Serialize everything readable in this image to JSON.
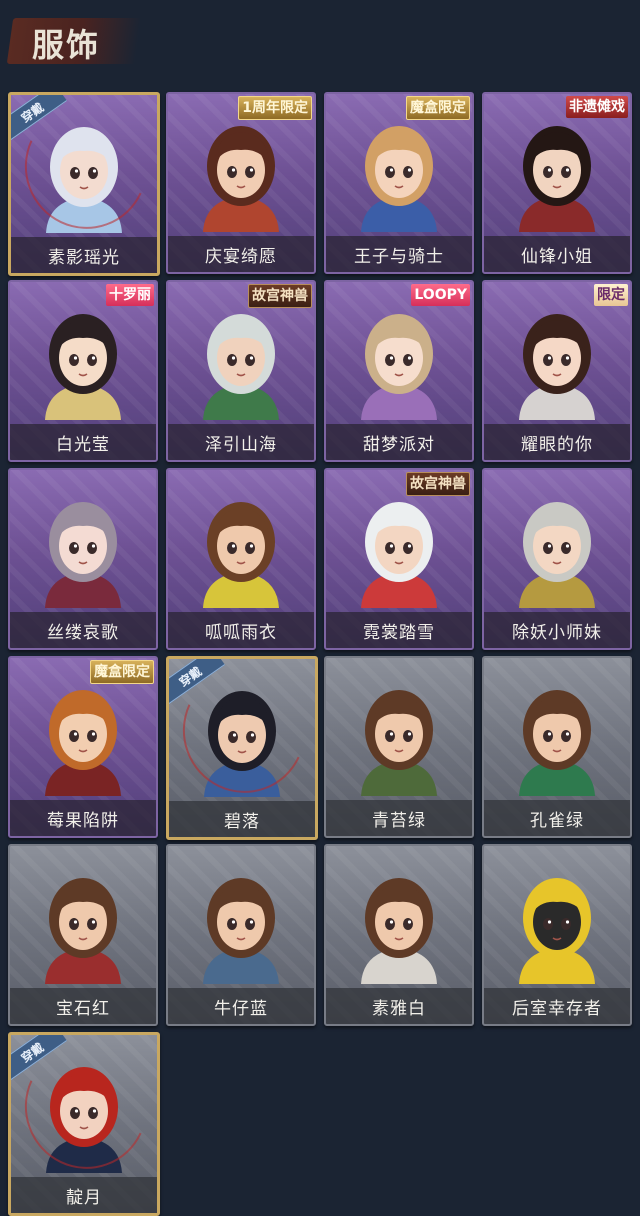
{
  "header": {
    "title": "服饰"
  },
  "cards": [
    {
      "name": "素影瑶光",
      "theme": "purple",
      "worn": true,
      "worn_label": "穿戴",
      "badge": "",
      "hair": "#dfe3ee",
      "skin": "#f3dcd0",
      "outfit": "#a7c6e6"
    },
    {
      "name": "庆宴绮愿",
      "theme": "purple",
      "worn": false,
      "worn_label": "",
      "badge": "1周年限定",
      "badge_style": "gold",
      "hair": "#5a2b1e",
      "skin": "#f1cdb3",
      "outfit": "#b0452f"
    },
    {
      "name": "王子与骑士",
      "theme": "purple",
      "worn": false,
      "worn_label": "",
      "badge": "魔盒限定",
      "badge_style": "gold",
      "hair": "#d2a065",
      "skin": "#f4d3bb",
      "outfit": "#3b5ea8"
    },
    {
      "name": "仙锋小姐",
      "theme": "purple",
      "worn": false,
      "worn_label": "",
      "badge": "非遗傩戏",
      "badge_style": "red",
      "hair": "#241714",
      "skin": "#f1d4c0",
      "outfit": "#8a2a2a"
    },
    {
      "name": "白光莹",
      "theme": "purple",
      "worn": false,
      "worn_label": "",
      "badge": "十罗丽",
      "badge_style": "pink",
      "hair": "#2a2022",
      "skin": "#f5dcc8",
      "outfit": "#d9c27a"
    },
    {
      "name": "泽引山海",
      "theme": "purple",
      "worn": false,
      "worn_label": "",
      "badge": "故宫神兽",
      "badge_style": "dark",
      "hair": "#d4dbd9",
      "skin": "#f0d2bd",
      "outfit": "#3f7a4a"
    },
    {
      "name": "甜梦派对",
      "theme": "purple",
      "worn": false,
      "worn_label": "",
      "badge": "LOOPY",
      "badge_style": "pink",
      "hair": "#cbb08a",
      "skin": "#f6ddcd",
      "outfit": "#9a6fb8"
    },
    {
      "name": "耀眼的你",
      "theme": "purple",
      "worn": false,
      "worn_label": "",
      "badge": "限定",
      "badge_style": "cream",
      "hair": "#3a221b",
      "skin": "#f5d8c6",
      "outfit": "#d6d2d0"
    },
    {
      "name": "丝缕哀歌",
      "theme": "purple",
      "worn": false,
      "worn_label": "",
      "badge": "",
      "hair": "#9a8e9e",
      "skin": "#f4dbd3",
      "outfit": "#7a2a3c"
    },
    {
      "name": "呱呱雨衣",
      "theme": "purple",
      "worn": false,
      "worn_label": "",
      "badge": "",
      "hair": "#6b4026",
      "skin": "#efc9ac",
      "outfit": "#d7c53a"
    },
    {
      "name": "霓裳踏雪",
      "theme": "purple",
      "worn": false,
      "worn_label": "",
      "badge": "故宫神兽",
      "badge_style": "dark",
      "hair": "#eceff0",
      "skin": "#f3d6c2",
      "outfit": "#cc3a3a"
    },
    {
      "name": "除妖小师妹",
      "theme": "purple",
      "worn": false,
      "worn_label": "",
      "badge": "",
      "hair": "#c9c9c4",
      "skin": "#f3d7c3",
      "outfit": "#b59a40"
    },
    {
      "name": "莓果陷阱",
      "theme": "purple",
      "worn": false,
      "worn_label": "",
      "badge": "魔盒限定",
      "badge_style": "gold",
      "hair": "#c06a2a",
      "skin": "#f2ceb0",
      "outfit": "#7a2424"
    },
    {
      "name": "碧落",
      "theme": "gray",
      "worn": true,
      "worn_label": "穿戴",
      "badge": "",
      "hair": "#1e1e28",
      "skin": "#eecab0",
      "outfit": "#3a5e9c"
    },
    {
      "name": "青苔绿",
      "theme": "gray",
      "worn": false,
      "worn_label": "",
      "badge": "",
      "hair": "#5e3a26",
      "skin": "#efc9ac",
      "outfit": "#4e6a3a"
    },
    {
      "name": "孔雀绿",
      "theme": "gray",
      "worn": false,
      "worn_label": "",
      "badge": "",
      "hair": "#5e3a26",
      "skin": "#efc9ac",
      "outfit": "#2e7a4e"
    },
    {
      "name": "宝石红",
      "theme": "gray",
      "worn": false,
      "worn_label": "",
      "badge": "",
      "hair": "#5e3a26",
      "skin": "#efc9ac",
      "outfit": "#9a2e2e"
    },
    {
      "name": "牛仔蓝",
      "theme": "gray",
      "worn": false,
      "worn_label": "",
      "badge": "",
      "hair": "#5e3a26",
      "skin": "#efc9ac",
      "outfit": "#4a6a8e"
    },
    {
      "name": "素雅白",
      "theme": "gray",
      "worn": false,
      "worn_label": "",
      "badge": "",
      "hair": "#5e3a26",
      "skin": "#efc9ac",
      "outfit": "#d8d4ce"
    },
    {
      "name": "后室幸存者",
      "theme": "gray",
      "worn": false,
      "worn_label": "",
      "badge": "",
      "hair": "#e7c52a",
      "skin": "#2a2a2a",
      "outfit": "#e7c52a"
    },
    {
      "name": "靛月",
      "theme": "gray",
      "worn": true,
      "worn_label": "穿戴",
      "badge": "",
      "hair": "#b8261e",
      "skin": "#f2d2c0",
      "outfit": "#1f2b48"
    }
  ]
}
